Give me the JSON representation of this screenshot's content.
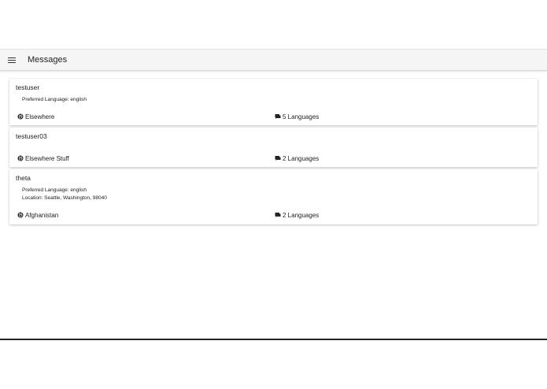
{
  "toolbar": {
    "title": "Messages",
    "menu_icon": "menu-icon"
  },
  "cards": [
    {
      "name": "testuser",
      "preferred_language": "Preferred Language: english",
      "location_detail": "",
      "location": "Elsewhere",
      "languages": "5 Languages"
    },
    {
      "name": "testuser03",
      "preferred_language": "",
      "location_detail": "",
      "location": "Elsewhere Stuff",
      "languages": "2 Languages"
    },
    {
      "name": "theta",
      "preferred_language": "Preferred Language: english",
      "location_detail": "Location: Seattle, Washington, 98040",
      "location": "Afghanistan",
      "languages": "2 Languages"
    }
  ],
  "icons": {
    "location": "globe-icon",
    "languages": "chat-bubbles-icon"
  }
}
